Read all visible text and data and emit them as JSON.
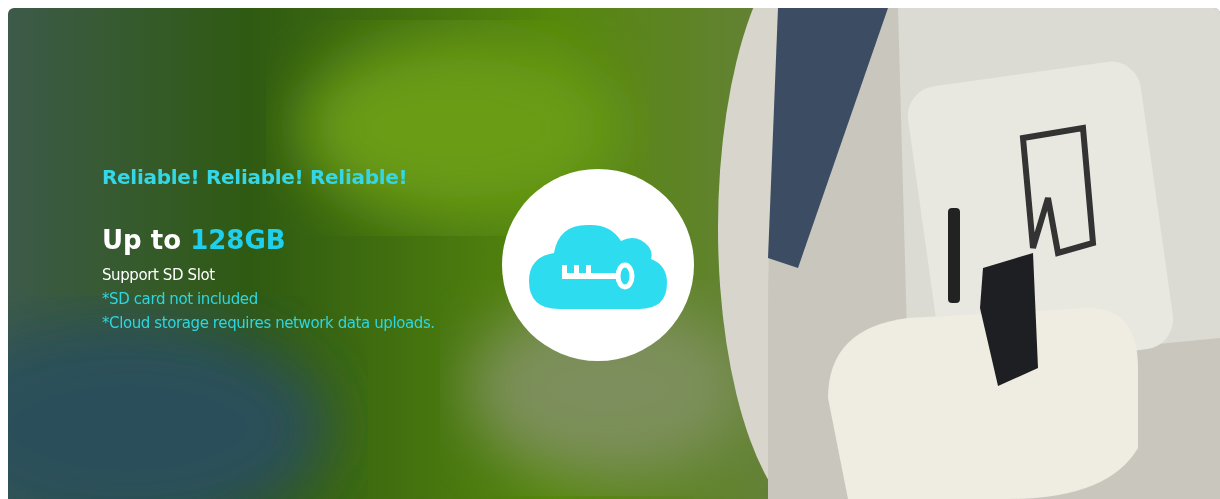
{
  "banner": {
    "kind": "picture",
    "tagline": "Reliable! Reliable! Reliable!",
    "headline": {
      "prefix": "Up to",
      "highlight": "128GB"
    },
    "lines": [
      {
        "text": "Support SD Slot",
        "kind": "plain"
      },
      {
        "text": "*SD card not included",
        "kind": "note"
      },
      {
        "text": "*Cloud storage requires network data uploads.",
        "kind": "note"
      }
    ]
  }
}
